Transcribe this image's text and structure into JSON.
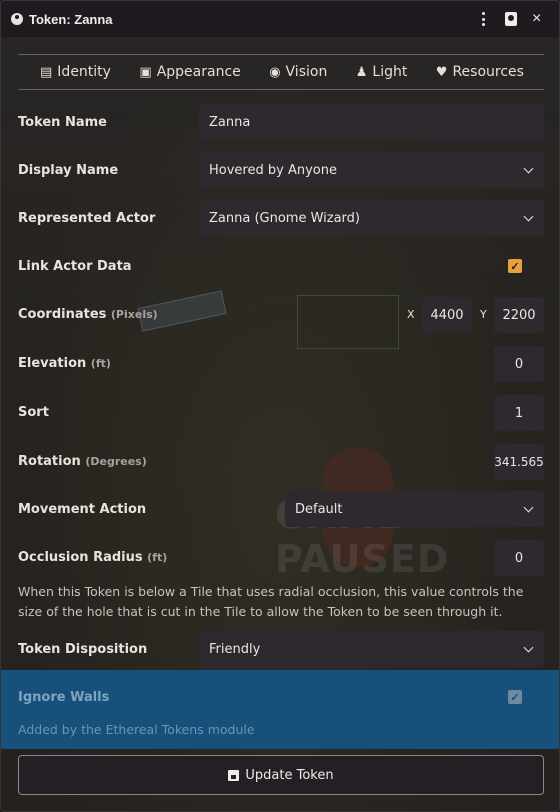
{
  "window": {
    "title": "Token: Zanna",
    "close_glyph": "×"
  },
  "backdrop": {
    "paused_text": "GAME PAUSED"
  },
  "tabs": [
    {
      "label": "Identity",
      "icon": "id-card-icon",
      "glyph": "▤",
      "active": true
    },
    {
      "label": "Appearance",
      "icon": "portrait-icon",
      "glyph": "▣",
      "active": false
    },
    {
      "label": "Vision",
      "icon": "eye-icon",
      "glyph": "◉",
      "active": false
    },
    {
      "label": "Light",
      "icon": "lightbulb-icon",
      "glyph": "♟",
      "active": false
    },
    {
      "label": "Resources",
      "icon": "heart-icon",
      "glyph": "♥",
      "active": false
    }
  ],
  "fields": {
    "token_name": {
      "label": "Token Name",
      "value": "Zanna"
    },
    "display_name": {
      "label": "Display Name",
      "value": "Hovered by Anyone"
    },
    "represented_actor": {
      "label": "Represented Actor",
      "value": "Zanna (Gnome Wizard)"
    },
    "link_actor_data": {
      "label": "Link Actor Data",
      "checked": true
    },
    "coordinates": {
      "label": "Coordinates",
      "unit": "(Pixels)",
      "x_label": "X",
      "x": "4400",
      "y_label": "Y",
      "y": "2200"
    },
    "elevation": {
      "label": "Elevation",
      "unit": "(ft)",
      "value": "0"
    },
    "sort": {
      "label": "Sort",
      "value": "1"
    },
    "rotation": {
      "label": "Rotation",
      "unit": "(Degrees)",
      "value": "341.565"
    },
    "movement_action": {
      "label": "Movement Action",
      "value": "Default"
    },
    "occlusion_radius": {
      "label": "Occlusion Radius",
      "unit": "(ft)",
      "value": "0"
    },
    "occlusion_hint": "When this Token is below a Tile that uses radial occlusion, this value controls the size of the hole that is cut in the Tile to allow the Token to be seen through it.",
    "token_disposition": {
      "label": "Token Disposition",
      "value": "Friendly"
    },
    "ignore_walls": {
      "label": "Ignore Walls",
      "checked": true,
      "note": "Added by the Ethereal Tokens module"
    }
  },
  "footer": {
    "button_label": "Update Token"
  },
  "colors": {
    "accent": "#e5a23d",
    "highlight_band": "#16507b",
    "background": "#242026"
  }
}
